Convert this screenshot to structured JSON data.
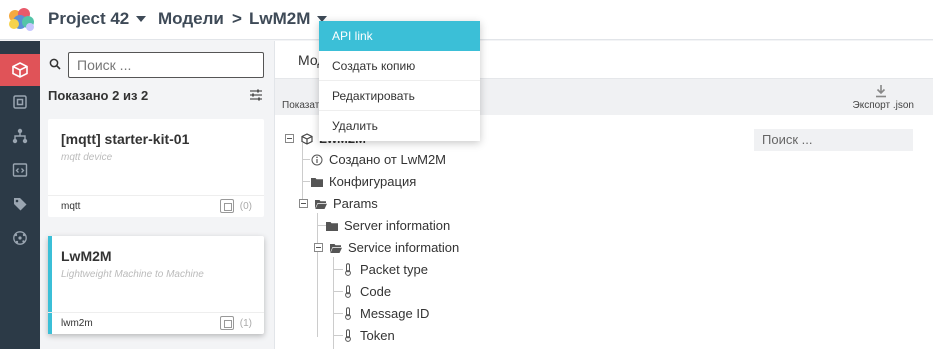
{
  "header": {
    "project_label": "Project 42",
    "section_label": "Модели",
    "separator": ">",
    "model_label": "LwM2M"
  },
  "menu": {
    "items": [
      {
        "label": "API link",
        "active": true
      },
      {
        "label": "Создать копию",
        "active": false
      },
      {
        "label": "Редактировать",
        "active": false
      },
      {
        "label": "Удалить",
        "active": false
      }
    ]
  },
  "list": {
    "search_placeholder": "Поиск ...",
    "shown_text": "Показано 2 из 2",
    "cards": [
      {
        "title": "[mqtt] starter-kit-01",
        "subtitle": "mqtt device",
        "tag": "mqtt",
        "count": "(0)",
        "active": false
      },
      {
        "title": "LwM2M",
        "subtitle": "Lightweight Machine to Machine",
        "tag": "lwm2m",
        "count": "(1)",
        "active": true
      }
    ]
  },
  "main": {
    "tab_label": "Мод",
    "toolbar_show_label": "Показат",
    "toolbar_export_label": "Экспорт .json",
    "tree_search_placeholder": "Поиск ...",
    "tree": {
      "root_label": "LwM2M",
      "created_from": "Создано от LwM2M",
      "configuration": "Конфигурация",
      "params": "Params",
      "server_info": "Server information",
      "service_info": "Service information",
      "leaves": [
        "Packet type",
        "Code",
        "Message ID",
        "Token"
      ]
    }
  },
  "colors": {
    "accent": "#3bbfd7",
    "active_nav": "#e05358",
    "sidebar_bg": "#2c3a47"
  }
}
